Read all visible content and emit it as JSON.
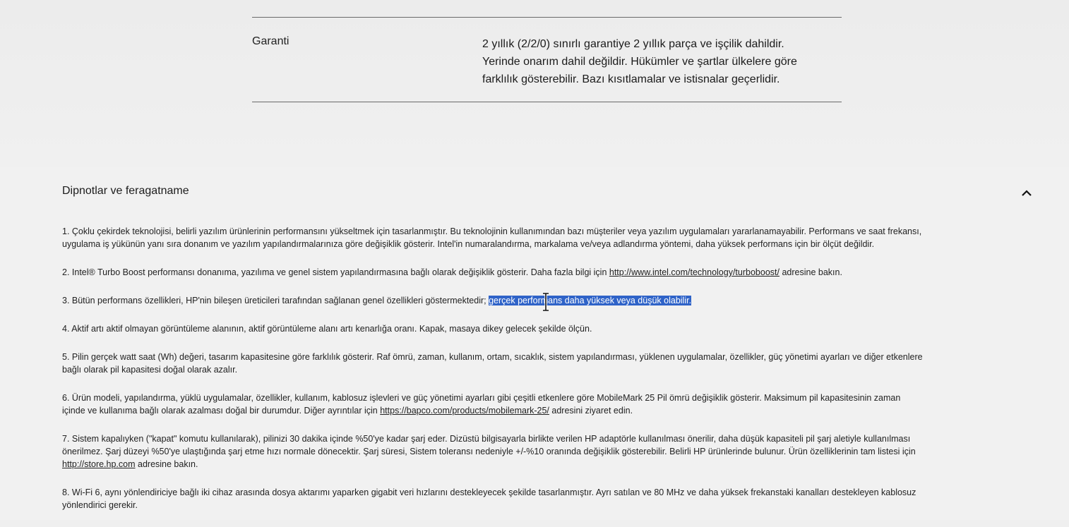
{
  "spec": {
    "label": "Garanti",
    "value_lines": [
      "2 yıllık (2/2/0) sınırlı garantiye 2 yıllık parça ve işçilik dahildir.",
      "Yerinde onarım dahil değildir. Hükümler ve şartlar ülkelere göre",
      "farklılık gösterebilir. Bazı kısıtlamalar ve istisnalar geçerlidir."
    ]
  },
  "footnotes": {
    "header": "Dipnotlar ve feragatname",
    "collapse_icon": "chevron-up-icon",
    "selection_color": "#2f63c8",
    "items": [
      {
        "line1": "1. Çoklu çekirdek teknolojisi, belirli yazılım ürünlerinin performansını yükseltmek için tasarlanmıştır. Bu teknolojinin kullanımından bazı müşteriler veya yazılım uygulamaları yararlanamayabilir. Performans ve saat frekansı,",
        "line2": "uygulama iş yükünün yanı sıra donanım ve yazılım yapılandırmalarınıza göre değişiklik gösterir. Intel'in numaralandırma, markalama ve/veya adlandırma yöntemi, daha yüksek performans için bir ölçüt değildir."
      },
      {
        "before": "2. Intel® Turbo Boost performansı donanıma, yazılıma ve genel sistem yapılandırmasına bağlı olarak değişiklik gösterir. Daha fazla bilgi için ",
        "link": "http://www.intel.com/technology/turboboost/",
        "after": " adresine bakın."
      },
      {
        "before": "3. Bütün performans özellikleri, HP'nin bileşen üreticileri tarafından sağlanan genel özellikleri göstermektedir; ",
        "selected": "gerçek performans daha yüksek veya düşük olabilir."
      },
      {
        "text": "4. Aktif artı aktif olmayan görüntüleme alanının, aktif görüntüleme alanı artı kenarlığa oranı. Kapak, masaya dikey gelecek şekilde ölçün."
      },
      {
        "line1": "5. Pilin gerçek watt saat (Wh) değeri, tasarım kapasitesine göre farklılık gösterir. Raf ömrü, zaman, kullanım, ortam, sıcaklık, sistem yapılandırması, yüklenen uygulamalar, özellikler, güç yönetimi ayarları ve diğer etkenlere",
        "line2": "bağlı olarak pil kapasitesi doğal olarak azalır."
      },
      {
        "line1": "6. Ürün modeli, yapılandırma, yüklü uygulamalar, özellikler, kullanım, kablosuz işlevleri ve güç yönetimi ayarları gibi çeşitli etkenlere göre MobileMark 25 Pil ömrü değişiklik gösterir. Maksimum pil kapasitesinin zaman",
        "line2_before": "içinde ve kullanıma bağlı olarak azalması doğal bir durumdur. Diğer ayrıntılar için ",
        "link": "https://bapco.com/products/mobilemark-25/",
        "line2_after": " adresini ziyaret edin."
      },
      {
        "line1": "7. Sistem kapalıyken (\"kapat\" komutu kullanılarak), pilinizi 30 dakika içinde %50'ye kadar şarj eder. Dizüstü bilgisayarla birlikte verilen HP adaptörle kullanılması önerilir, daha düşük kapasiteli pil şarj aletiyle kullanılması",
        "line2": "önerilmez. Şarj düzeyi %50'ye ulaştığında şarj etme hızı normale dönecektir. Şarj süresi, Sistem toleransı nedeniyle +/-%10 oranında değişiklik gösterebilir. Belirli HP ürünlerinde bulunur. Ürün özelliklerinin tam listesi için",
        "link": "http://store.hp.com",
        "line3_after": " adresine bakın."
      },
      {
        "line1": "8. Wi-Fi 6, aynı yönlendiriciye bağlı iki cihaz arasında dosya aktarımı yaparken gigabit veri hızlarını destekleyecek şekilde tasarlanmıştır. Ayrı satılan ve 80 MHz ve daha yüksek frekanstaki kanalları destekleyen kablosuz",
        "line2": "yönlendirici gerekir."
      }
    ]
  }
}
